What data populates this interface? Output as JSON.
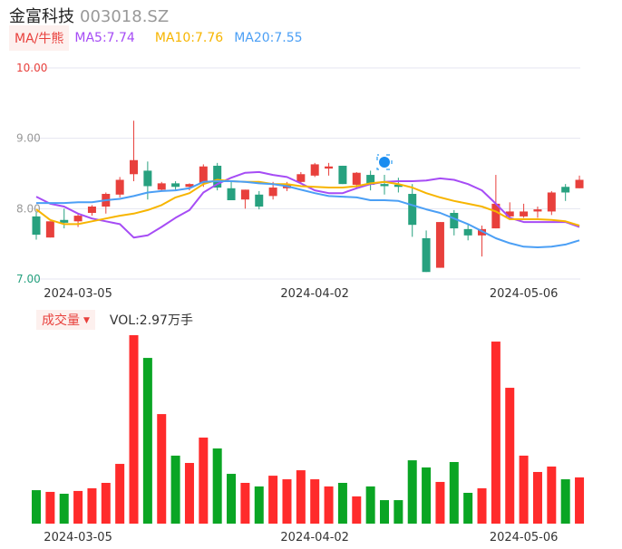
{
  "header": {
    "name": "金富科技",
    "code": "003018.SZ"
  },
  "ma_legend": {
    "button": "MA/牛熊",
    "ma5": "MA5:7.74",
    "ma10": "MA10:7.76",
    "ma20": "MA20:7.55"
  },
  "volume_legend": {
    "button": "成交量",
    "arrow": "▼",
    "value": "VOL:2.97万手"
  },
  "colors": {
    "up": "#e8403c",
    "down": "#27a17f",
    "ma5": "#a64cf5",
    "ma10": "#f7b500",
    "ma20": "#4b9ff5",
    "grid": "#e4e6f0"
  },
  "chart_data": [
    {
      "type": "candlestick",
      "title": "金富科技 003018.SZ",
      "ylim": [
        7,
        10
      ],
      "y_ticks": [
        "10.00",
        "9.00",
        "8.00",
        "7.00"
      ],
      "y_tick_values": [
        10,
        9,
        8,
        7
      ],
      "x_tick_labels": [
        {
          "index": 3,
          "label": "2024-03-05"
        },
        {
          "index": 20,
          "label": "2024-04-02"
        },
        {
          "index": 35,
          "label": "2024-05-06"
        }
      ],
      "ohlc": [
        [
          7.89,
          7.95,
          7.56,
          7.63
        ],
        [
          7.59,
          7.82,
          7.59,
          7.82
        ],
        [
          7.84,
          8.0,
          7.72,
          7.8
        ],
        [
          7.82,
          7.94,
          7.74,
          7.9
        ],
        [
          7.94,
          8.05,
          7.9,
          8.03
        ],
        [
          8.03,
          8.23,
          7.93,
          8.21
        ],
        [
          8.2,
          8.45,
          8.16,
          8.41
        ],
        [
          8.49,
          9.25,
          8.39,
          8.69
        ],
        [
          8.54,
          8.67,
          8.13,
          8.32
        ],
        [
          8.27,
          8.38,
          8.25,
          8.36
        ],
        [
          8.36,
          8.39,
          8.27,
          8.31
        ],
        [
          8.31,
          8.36,
          8.26,
          8.35
        ],
        [
          8.36,
          8.63,
          8.31,
          8.6
        ],
        [
          8.61,
          8.65,
          8.26,
          8.3
        ],
        [
          8.29,
          8.39,
          8.12,
          8.12
        ],
        [
          8.13,
          8.27,
          8.0,
          8.27
        ],
        [
          8.2,
          8.25,
          7.99,
          8.03
        ],
        [
          8.18,
          8.38,
          8.13,
          8.3
        ],
        [
          8.29,
          8.38,
          8.25,
          8.35
        ],
        [
          8.38,
          8.52,
          8.35,
          8.49
        ],
        [
          8.47,
          8.65,
          8.45,
          8.63
        ],
        [
          8.57,
          8.65,
          8.47,
          8.6
        ],
        [
          8.61,
          8.61,
          8.35,
          8.35
        ],
        [
          8.34,
          8.52,
          8.3,
          8.51
        ],
        [
          8.48,
          8.54,
          8.26,
          8.34
        ],
        [
          8.35,
          8.48,
          8.2,
          8.32
        ],
        [
          8.34,
          8.44,
          8.23,
          8.31
        ],
        [
          8.21,
          8.35,
          7.6,
          7.77
        ],
        [
          7.58,
          7.69,
          7.1,
          7.1
        ],
        [
          7.16,
          7.81,
          7.16,
          7.81
        ],
        [
          7.94,
          7.98,
          7.62,
          7.72
        ],
        [
          7.71,
          7.77,
          7.55,
          7.62
        ],
        [
          7.62,
          7.76,
          7.32,
          7.71
        ],
        [
          7.72,
          8.48,
          7.72,
          8.07
        ],
        [
          7.89,
          8.09,
          7.86,
          7.96
        ],
        [
          7.89,
          8.07,
          7.87,
          7.96
        ],
        [
          7.96,
          8.03,
          7.87,
          7.99
        ],
        [
          7.96,
          8.25,
          7.91,
          8.23
        ],
        [
          8.31,
          8.35,
          8.11,
          8.23
        ],
        [
          8.29,
          8.47,
          8.29,
          8.41
        ]
      ],
      "ohlc_order": [
        "open",
        "high",
        "low",
        "close"
      ],
      "series": [
        {
          "name": "MA5",
          "values": [
            8.17,
            8.07,
            8.03,
            7.93,
            7.86,
            7.82,
            7.78,
            7.59,
            7.62,
            7.74,
            7.87,
            7.98,
            8.23,
            8.35,
            8.44,
            8.51,
            8.52,
            8.48,
            8.45,
            8.36,
            8.26,
            8.22,
            8.22,
            8.29,
            8.35,
            8.38,
            8.39,
            8.39,
            8.4,
            8.43,
            8.41,
            8.35,
            8.26,
            8.07,
            7.87,
            7.81,
            7.81,
            7.81,
            7.81,
            7.74
          ]
        },
        {
          "name": "MA10",
          "values": [
            7.99,
            7.84,
            7.78,
            7.78,
            7.82,
            7.86,
            7.9,
            7.93,
            7.98,
            8.05,
            8.16,
            8.22,
            8.35,
            8.41,
            8.39,
            8.38,
            8.38,
            8.35,
            8.35,
            8.32,
            8.31,
            8.3,
            8.3,
            8.32,
            8.36,
            8.38,
            8.35,
            8.3,
            8.22,
            8.16,
            8.11,
            8.07,
            8.03,
            7.96,
            7.85,
            7.85,
            7.85,
            7.84,
            7.82,
            7.76
          ]
        },
        {
          "name": "MA20",
          "values": [
            8.08,
            8.08,
            8.08,
            8.09,
            8.09,
            8.12,
            8.14,
            8.18,
            8.23,
            8.25,
            8.26,
            8.29,
            8.38,
            8.39,
            8.39,
            8.38,
            8.36,
            8.35,
            8.32,
            8.27,
            8.22,
            8.18,
            8.17,
            8.16,
            8.12,
            8.12,
            8.11,
            8.05,
            7.99,
            7.94,
            7.86,
            7.78,
            7.68,
            7.58,
            7.51,
            7.46,
            7.45,
            7.46,
            7.49,
            7.55
          ]
        }
      ]
    },
    {
      "type": "bar",
      "title": "成交量",
      "ylabel": "万手",
      "x_tick_labels": [
        {
          "index": 3,
          "label": "2024-03-05"
        },
        {
          "index": 20,
          "label": "2024-04-02"
        },
        {
          "index": 35,
          "label": "2024-05-06"
        }
      ],
      "values": [
        2.15,
        2.04,
        1.92,
        2.1,
        2.27,
        2.62,
        3.84,
        12.11,
        10.65,
        7.04,
        4.37,
        3.9,
        5.53,
        4.83,
        3.2,
        2.62,
        2.39,
        3.08,
        2.85,
        3.43,
        2.85,
        2.39,
        2.62,
        1.75,
        2.39,
        1.51,
        1.51,
        4.07,
        3.61,
        2.68,
        3.96,
        1.98,
        2.27,
        11.7,
        8.73,
        4.37,
        3.32,
        3.67,
        2.85,
        2.97
      ]
    }
  ]
}
